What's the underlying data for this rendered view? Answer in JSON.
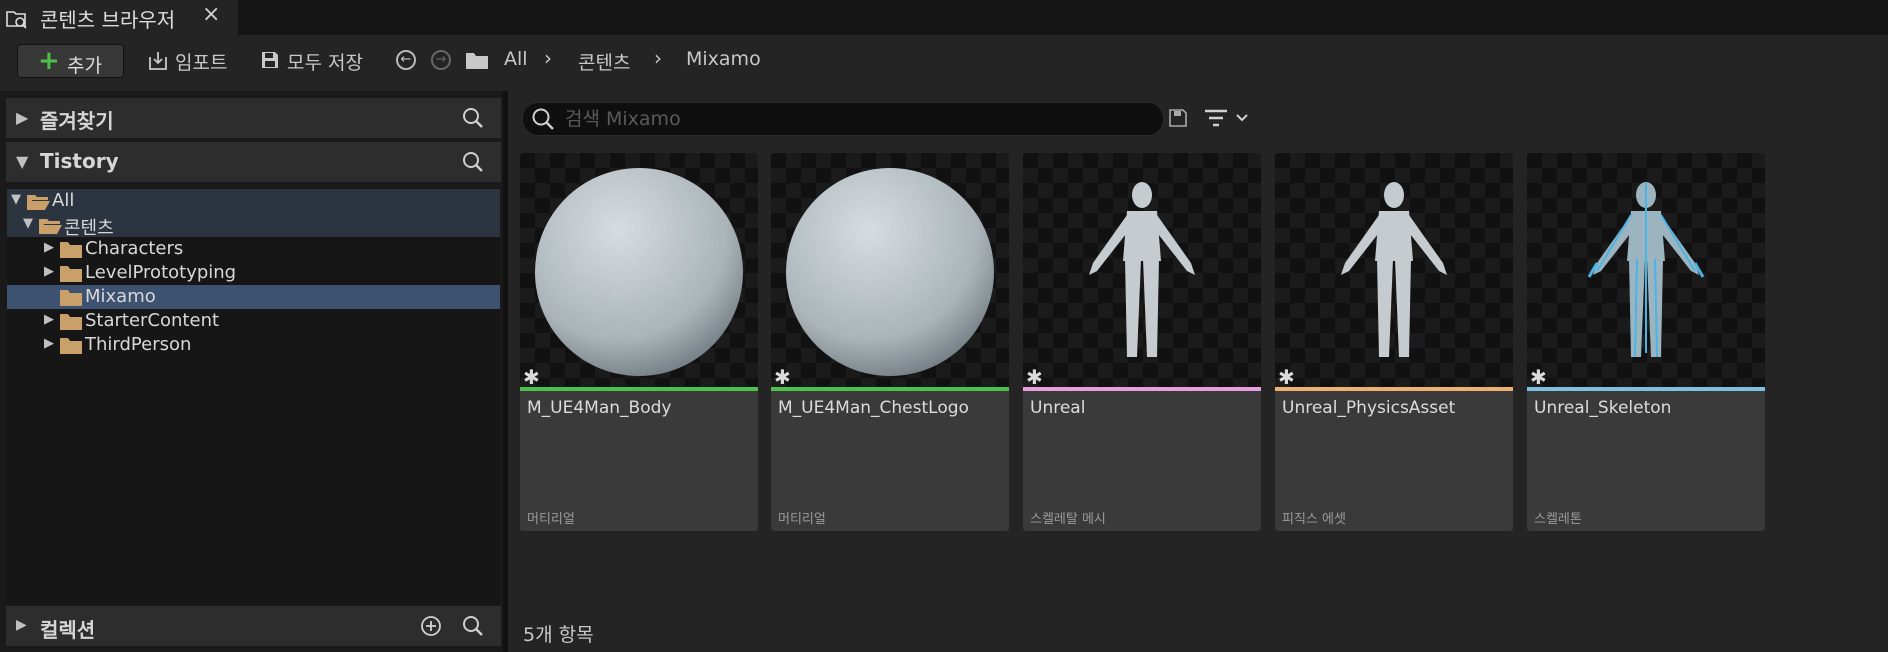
{
  "tab": {
    "title": "콘텐츠 브라우저",
    "close": "×"
  },
  "toolbar": {
    "add_label": "추가",
    "import_label": "임포트",
    "save_all_label": "모두 저장",
    "breadcrumb": [
      "All",
      "콘텐츠",
      "Mixamo"
    ]
  },
  "sidebar": {
    "favorites": "즐겨찾기",
    "project": "Tistory",
    "collections": "컬렉션",
    "tree": [
      {
        "label": "All",
        "depth": 0,
        "expanded": true,
        "open": true
      },
      {
        "label": "콘텐츠",
        "depth": 1,
        "expanded": true,
        "open": true
      },
      {
        "label": "Characters",
        "depth": 2,
        "expanded": false,
        "open": false
      },
      {
        "label": "LevelPrototyping",
        "depth": 2,
        "expanded": false,
        "open": false
      },
      {
        "label": "Mixamo",
        "depth": 2,
        "expanded": null,
        "open": false,
        "selected": true
      },
      {
        "label": "StarterContent",
        "depth": 2,
        "expanded": false,
        "open": false
      },
      {
        "label": "ThirdPerson",
        "depth": 2,
        "expanded": false,
        "open": false
      }
    ]
  },
  "search": {
    "placeholder": "검색 Mixamo"
  },
  "assets": [
    {
      "name": "M_UE4Man_Body",
      "type": "머티리얼",
      "color": "#4cc24a",
      "kind": "sphere"
    },
    {
      "name": "M_UE4Man_ChestLogo",
      "type": "머티리얼",
      "color": "#4cc24a",
      "kind": "sphere"
    },
    {
      "name": "Unreal",
      "type": "스켈레탈 메시",
      "color": "#e59ee0",
      "kind": "mannequin"
    },
    {
      "name": "Unreal_PhysicsAsset",
      "type": "피직스 에셋",
      "color": "#f0b070",
      "kind": "mannequin"
    },
    {
      "name": "Unreal_Skeleton",
      "type": "스켈레톤",
      "color": "#7ec0e0",
      "kind": "skeleton"
    }
  ],
  "status": {
    "count": "5개 항목"
  }
}
